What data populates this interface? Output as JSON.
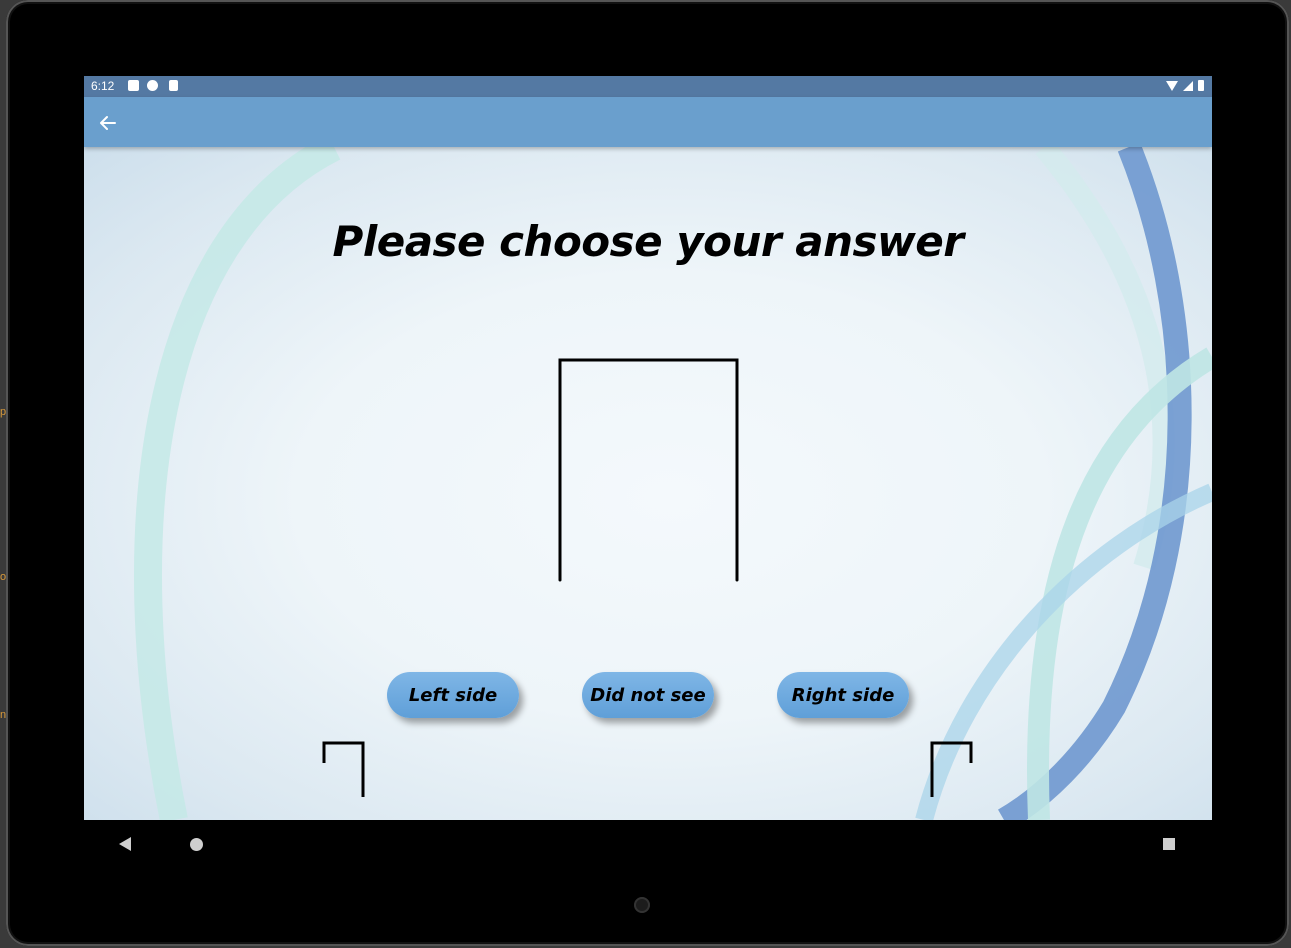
{
  "status_bar": {
    "time": "6:12",
    "notification_icons": [
      "a-icon",
      "chrome-icon",
      "sd-card-icon"
    ],
    "right_icons": [
      "wifi-icon",
      "signal-icon",
      "battery-icon"
    ]
  },
  "app_bar": {
    "back_icon": "arrow-left-icon"
  },
  "main": {
    "title": "Please choose your answer",
    "buttons": {
      "left": "Left side",
      "not_seen": "Did not see",
      "right": "Right side"
    }
  },
  "nav_bar": {
    "icons": [
      "nav-back-icon",
      "nav-home-icon",
      "nav-recents-icon"
    ]
  },
  "colors": {
    "status_bar": "#5479a3",
    "app_bar": "#6a9fcd",
    "button": "#6aa6dc",
    "swirl_blue": "#6f98cf",
    "swirl_teal": "#bfe6e4"
  }
}
